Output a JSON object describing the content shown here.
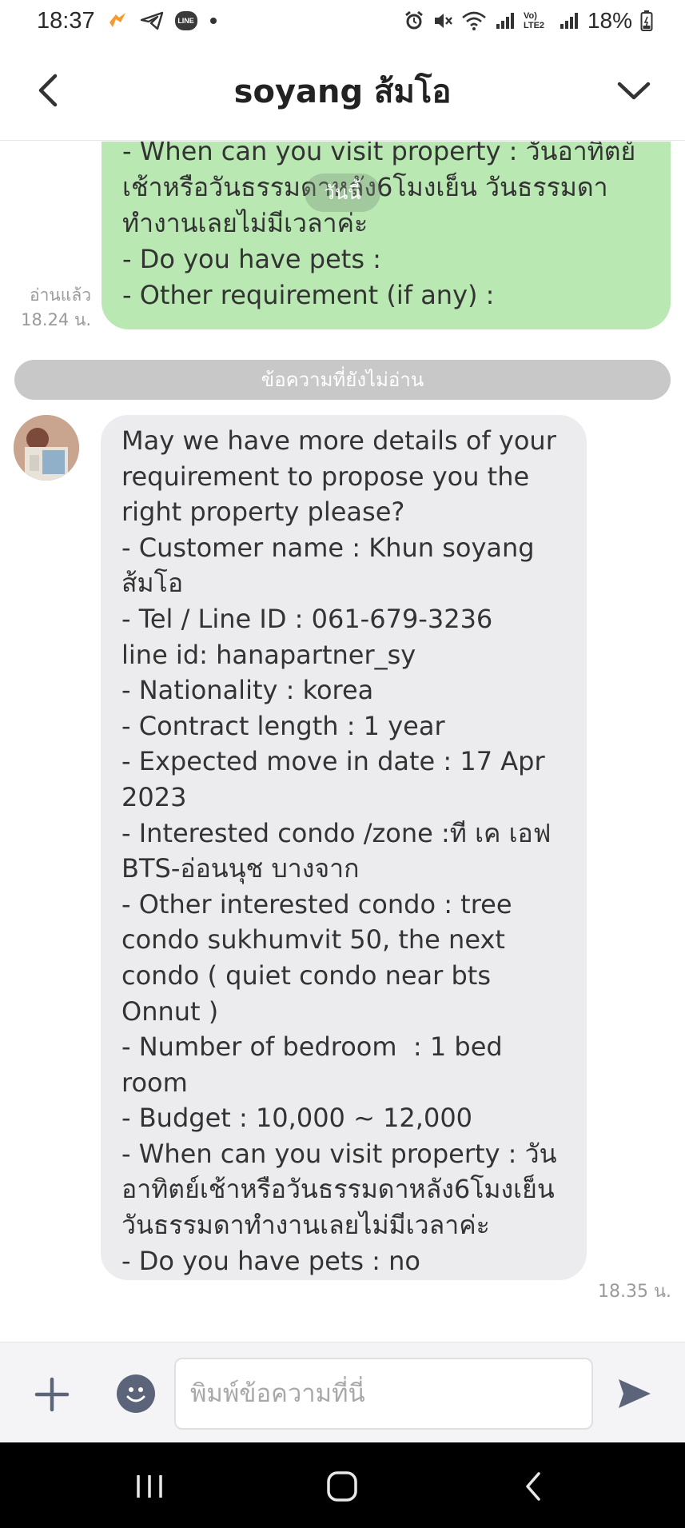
{
  "status_bar": {
    "time": "18:37",
    "battery": "18%",
    "line_badge": "LINE",
    "lte_label": "Vo) LTE2",
    "icons": [
      "compass-app-icon",
      "telegram-icon",
      "line-icon",
      "dot-icon",
      "alarm-icon",
      "mute-icon",
      "wifi-icon",
      "signal-icon",
      "signal-icon",
      "battery-icon"
    ]
  },
  "header": {
    "title": "soyang ส้มโอ",
    "back_icon": "chevron-left-icon",
    "menu_icon": "chevron-down-icon"
  },
  "chat": {
    "sent_message": {
      "text": "- When can you visit property : วันอาทิตย์เช้าหรือวันธรรมดาหลัง6โมงเย็น วันธรรมดาทำงานเลยไม่มีเวลาค่ะ\n- Do you have pets :\n- Other requirement (if any) :",
      "read_label": "อ่านแล้ว",
      "time": "18.24 น."
    },
    "date_chip": "วันนี้",
    "unread_divider": "ข้อความที่ยังไม่อ่าน",
    "received_message": {
      "text": "May we have more details of your requirement to propose you the right property please?\n- Customer name : Khun soyang ส้มโอ\n- Tel / Line ID : 061-679-3236\nline id: hanapartner_sy\n- Nationality : korea\n- Contract length : 1 year\n- Expected move in date : 17 Apr 2023\n- Interested condo /zone :ที เค เอฟ BTS-อ่อนนุช บางจาก\n- Other interested condo : tree condo sukhumvit 50, the next condo ( quiet condo near bts Onnut )\n- Number of bedroom  : 1 bed room\n- Budget : 10,000 ~ 12,000\n- When can you visit property : วันอาทิตย์เช้าหรือวันธรรมดาหลัง6โมงเย็น วันธรรมดาทำงานเลยไม่มีเวลาค่ะ\n- Do you have pets : no\n- Other requirement (if any) :",
      "time": "18.35 น."
    }
  },
  "input_bar": {
    "placeholder": "พิมพ์ข้อความที่นี่",
    "value": "",
    "icons": [
      "plus-icon",
      "emoji-icon",
      "send-icon"
    ]
  },
  "nav_bar": {
    "icons": [
      "recent-apps-icon",
      "home-icon",
      "back-icon"
    ]
  }
}
